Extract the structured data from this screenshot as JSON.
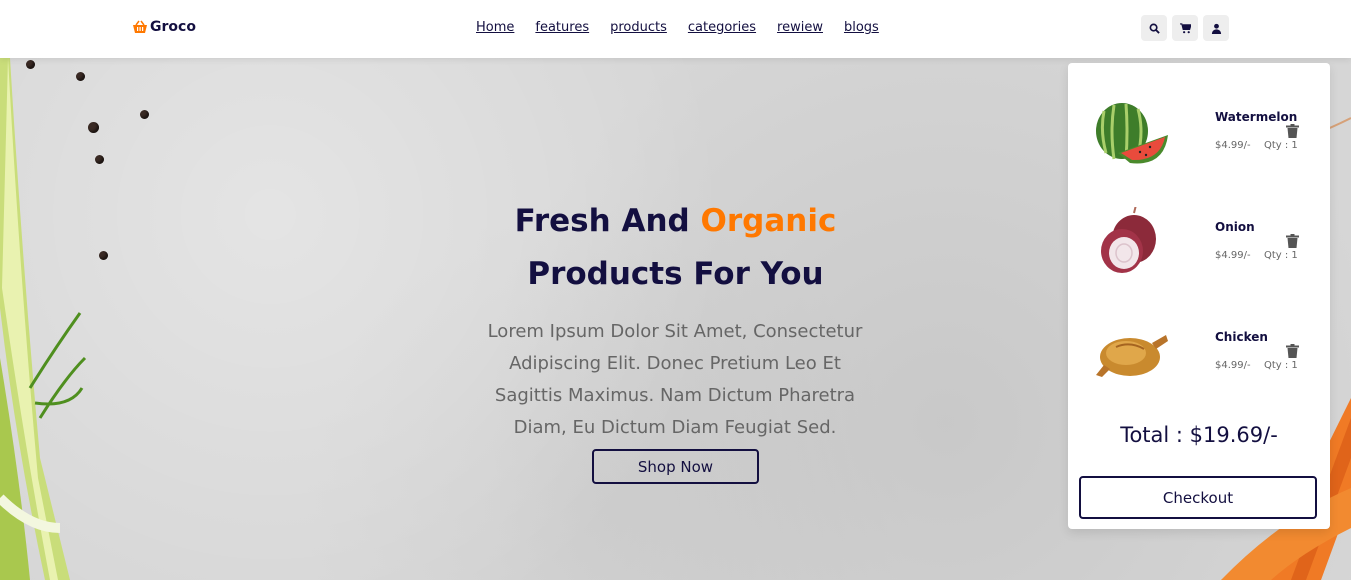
{
  "header": {
    "logo_text": "Groco",
    "nav": [
      "Home",
      "features",
      "products",
      "categories",
      "rewiew",
      "blogs"
    ],
    "icons": [
      "search-icon",
      "cart-icon",
      "user-icon"
    ]
  },
  "hero": {
    "title_part1": "Fresh And",
    "title_accent": "Organic",
    "title_line2": "Products For You",
    "text": "Lorem Ipsum Dolor Sit Amet, Consectetur Adipiscing Elit. Donec Pretium Leo Et Sagittis Maximus. Nam Dictum Pharetra Diam, Eu Dictum Diam Feugiat Sed.",
    "button_label": "Shop Now"
  },
  "cart": {
    "items": [
      {
        "name": "Watermelon",
        "price": "$4.99/-",
        "qty": "Qty : 1"
      },
      {
        "name": "Onion",
        "price": "$4.99/-",
        "qty": "Qty : 1"
      },
      {
        "name": "Chicken",
        "price": "$4.99/-",
        "qty": "Qty : 1"
      }
    ],
    "total": "Total : $19.69/-",
    "checkout_label": "Checkout"
  },
  "colors": {
    "accent": "#ff7800",
    "dark": "#130f40"
  }
}
